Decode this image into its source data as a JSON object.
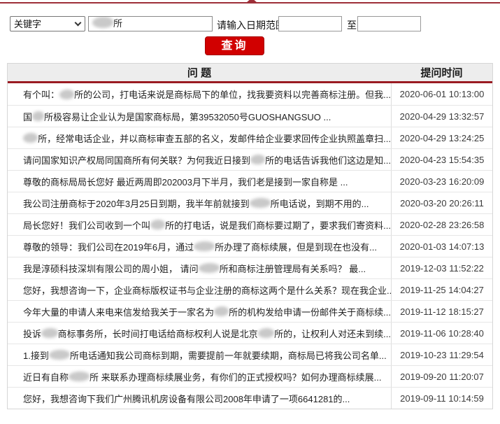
{
  "colors": {
    "top_divider_red": "#9d2f38",
    "button_red": "#d10000",
    "header_rule_red": "#9a1b22",
    "header_bg": "#ededed"
  },
  "search": {
    "field_type": {
      "value": "关键字"
    },
    "keyword": {
      "parts": [
        {
          "b": 2
        },
        {
          "t": "所"
        }
      ]
    },
    "date_range_label": "请输入日期范围",
    "date_from": "",
    "to_label": "至",
    "date_to": "",
    "submit_label": "查询"
  },
  "table": {
    "question_header": "问 题",
    "time_header": "提问时间",
    "rows": [
      {
        "parts": [
          {
            "t": "有个叫："
          },
          {
            "b": 2
          },
          {
            "t": "所的公司，打电话来说是商标局下的单位，找我要资料以完善商标注册。但我..."
          }
        ],
        "time": "2020-06-01 10:13:00"
      },
      {
        "parts": [
          {
            "t": "国"
          },
          {
            "b": 1
          },
          {
            "t": "所极容易让企业认为是国家商标局，第39532050号GUOSHANGSUO ..."
          }
        ],
        "time": "2020-04-29 13:32:57"
      },
      {
        "parts": [
          {
            "b": 2
          },
          {
            "t": "所，经常电话企业，并以商标审查五部的名义，发邮件给企业要求回传企业执照盖章扫..."
          }
        ],
        "time": "2020-04-29 13:24:25"
      },
      {
        "parts": [
          {
            "t": "请问国家知识产权局同国商所有何关联？为何我近日接到"
          },
          {
            "b": 2
          },
          {
            "t": "所的电话告诉我他们这边是知..."
          }
        ],
        "time": "2020-04-23 15:54:35"
      },
      {
        "parts": [
          {
            "t": "尊敬的商标局局长您好 最近两周即202003月下半月，我们老是接到一家自称是 ..."
          }
        ],
        "time": "2020-03-23 16:20:09"
      },
      {
        "parts": [
          {
            "t": "我公司注册商标于2020年3月25日到期，我半年前就接到"
          },
          {
            "b": 2
          },
          {
            "t": "所电话说，到期不用的..."
          }
        ],
        "time": "2020-03-20 20:26:11"
      },
      {
        "parts": [
          {
            "t": "局长您好！我们公司收到一个叫"
          },
          {
            "b": 2
          },
          {
            "t": "所的打电话，说是我们商标要过期了，要求我们寄资料..."
          }
        ],
        "time": "2020-02-28 23:26:58"
      },
      {
        "parts": [
          {
            "t": "尊敬的领导：我们公司在2019年6月，通过"
          },
          {
            "b": 2
          },
          {
            "t": "所办理了商标续展，但是到现在也没有..."
          }
        ],
        "time": "2020-01-03 14:07:13"
      },
      {
        "parts": [
          {
            "t": "我是淳硕科技深圳有限公司的周小姐， 请问"
          },
          {
            "b": 2
          },
          {
            "t": "所和商标注册管理局有关系吗？ 最..."
          }
        ],
        "time": "2019-12-03 11:52:22"
      },
      {
        "parts": [
          {
            "t": "您好，我想咨询一下，企业商标版权证书与企业注册的商标这两个是什么关系？现在我企业..."
          }
        ],
        "time": "2019-11-25 14:04:27"
      },
      {
        "parts": [
          {
            "t": "今年大量的申请人来电来信发给我关于一家名为"
          },
          {
            "b": 2
          },
          {
            "t": "所的机构发给申请一份邮件关于商标续..."
          }
        ],
        "time": "2019-11-12 18:15:27"
      },
      {
        "parts": [
          {
            "t": "投诉"
          },
          {
            "b": 2
          },
          {
            "t": "商标事务所，长时间打电话给商标权利人说是北京"
          },
          {
            "b": 2
          },
          {
            "t": "所的，让权利人对还未到续..."
          }
        ],
        "time": "2019-11-06 10:28:40"
      },
      {
        "parts": [
          {
            "t": "1.接到"
          },
          {
            "b": 2
          },
          {
            "t": "所电话通知我公司商标到期，需要提前一年就要续期，商标局已将我公司名单..."
          }
        ],
        "time": "2019-10-23 11:29:54"
      },
      {
        "parts": [
          {
            "t": "近日有自称"
          },
          {
            "b": 2
          },
          {
            "t": "所 来联系办理商标续展业务，有你们的正式授权吗？如何办理商标续展..."
          }
        ],
        "time": "2019-09-20 11:20:07"
      },
      {
        "parts": [
          {
            "t": "您好，我想咨询下我们广州腾讯机房设备有限公司2008年申请了一项6641281的..."
          }
        ],
        "time": "2019-09-11 10:14:59"
      }
    ]
  }
}
